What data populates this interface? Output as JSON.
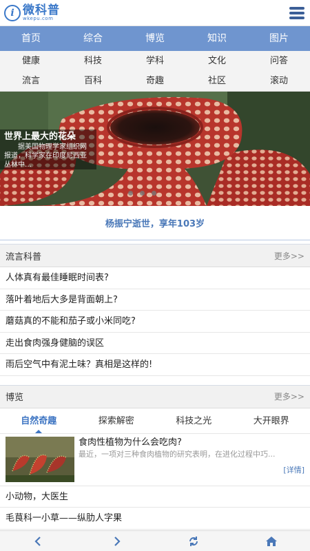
{
  "logo": {
    "cn": "微科普",
    "en": "wkepu.com",
    "mark": "i"
  },
  "nav_primary": [
    "首页",
    "综合",
    "博览",
    "知识",
    "图片"
  ],
  "nav_secondary": [
    [
      "健康",
      "科技",
      "学科",
      "文化",
      "问答"
    ],
    [
      "流言",
      "百科",
      "奇趣",
      "社区",
      "滚动"
    ]
  ],
  "hero": {
    "title": "世界上最大的花朵",
    "desc": "据美国物理学家组织网报道，科学家在印度尼西亚丛林中…"
  },
  "headline": "杨振宁逝世，享年103岁",
  "section_rumor": {
    "title": "流言科普",
    "more": "更多>>",
    "items": [
      "人体真有最佳睡眠时间表?",
      "落叶着地后大多是背面朝上?",
      "蘑菇真的不能和茄子或小米同吃?",
      "走出食肉强身健脑的误区",
      "雨后空气中有泥土味？真相是这样的!"
    ]
  },
  "section_expo": {
    "title": "博览",
    "more": "更多>>",
    "tabs": [
      "自然奇趣",
      "探索解密",
      "科技之光",
      "大开眼界"
    ],
    "feature": {
      "title": "食肉性植物为什么会吃肉?",
      "desc": "最近，一项对三种食肉植物的研究表明，在进化过程中巧...",
      "link": "[详情]"
    },
    "items": [
      "小动物，大医生",
      "毛茛科一小草——纵肋人字果"
    ]
  },
  "icons": [
    "arrow-left-icon",
    "arrow-right-icon",
    "refresh-icon",
    "home-icon",
    "menu-icon"
  ],
  "colors": {
    "brand": "#3a78c9",
    "nav": "#6f95cf",
    "accent": "#4a78b8"
  }
}
